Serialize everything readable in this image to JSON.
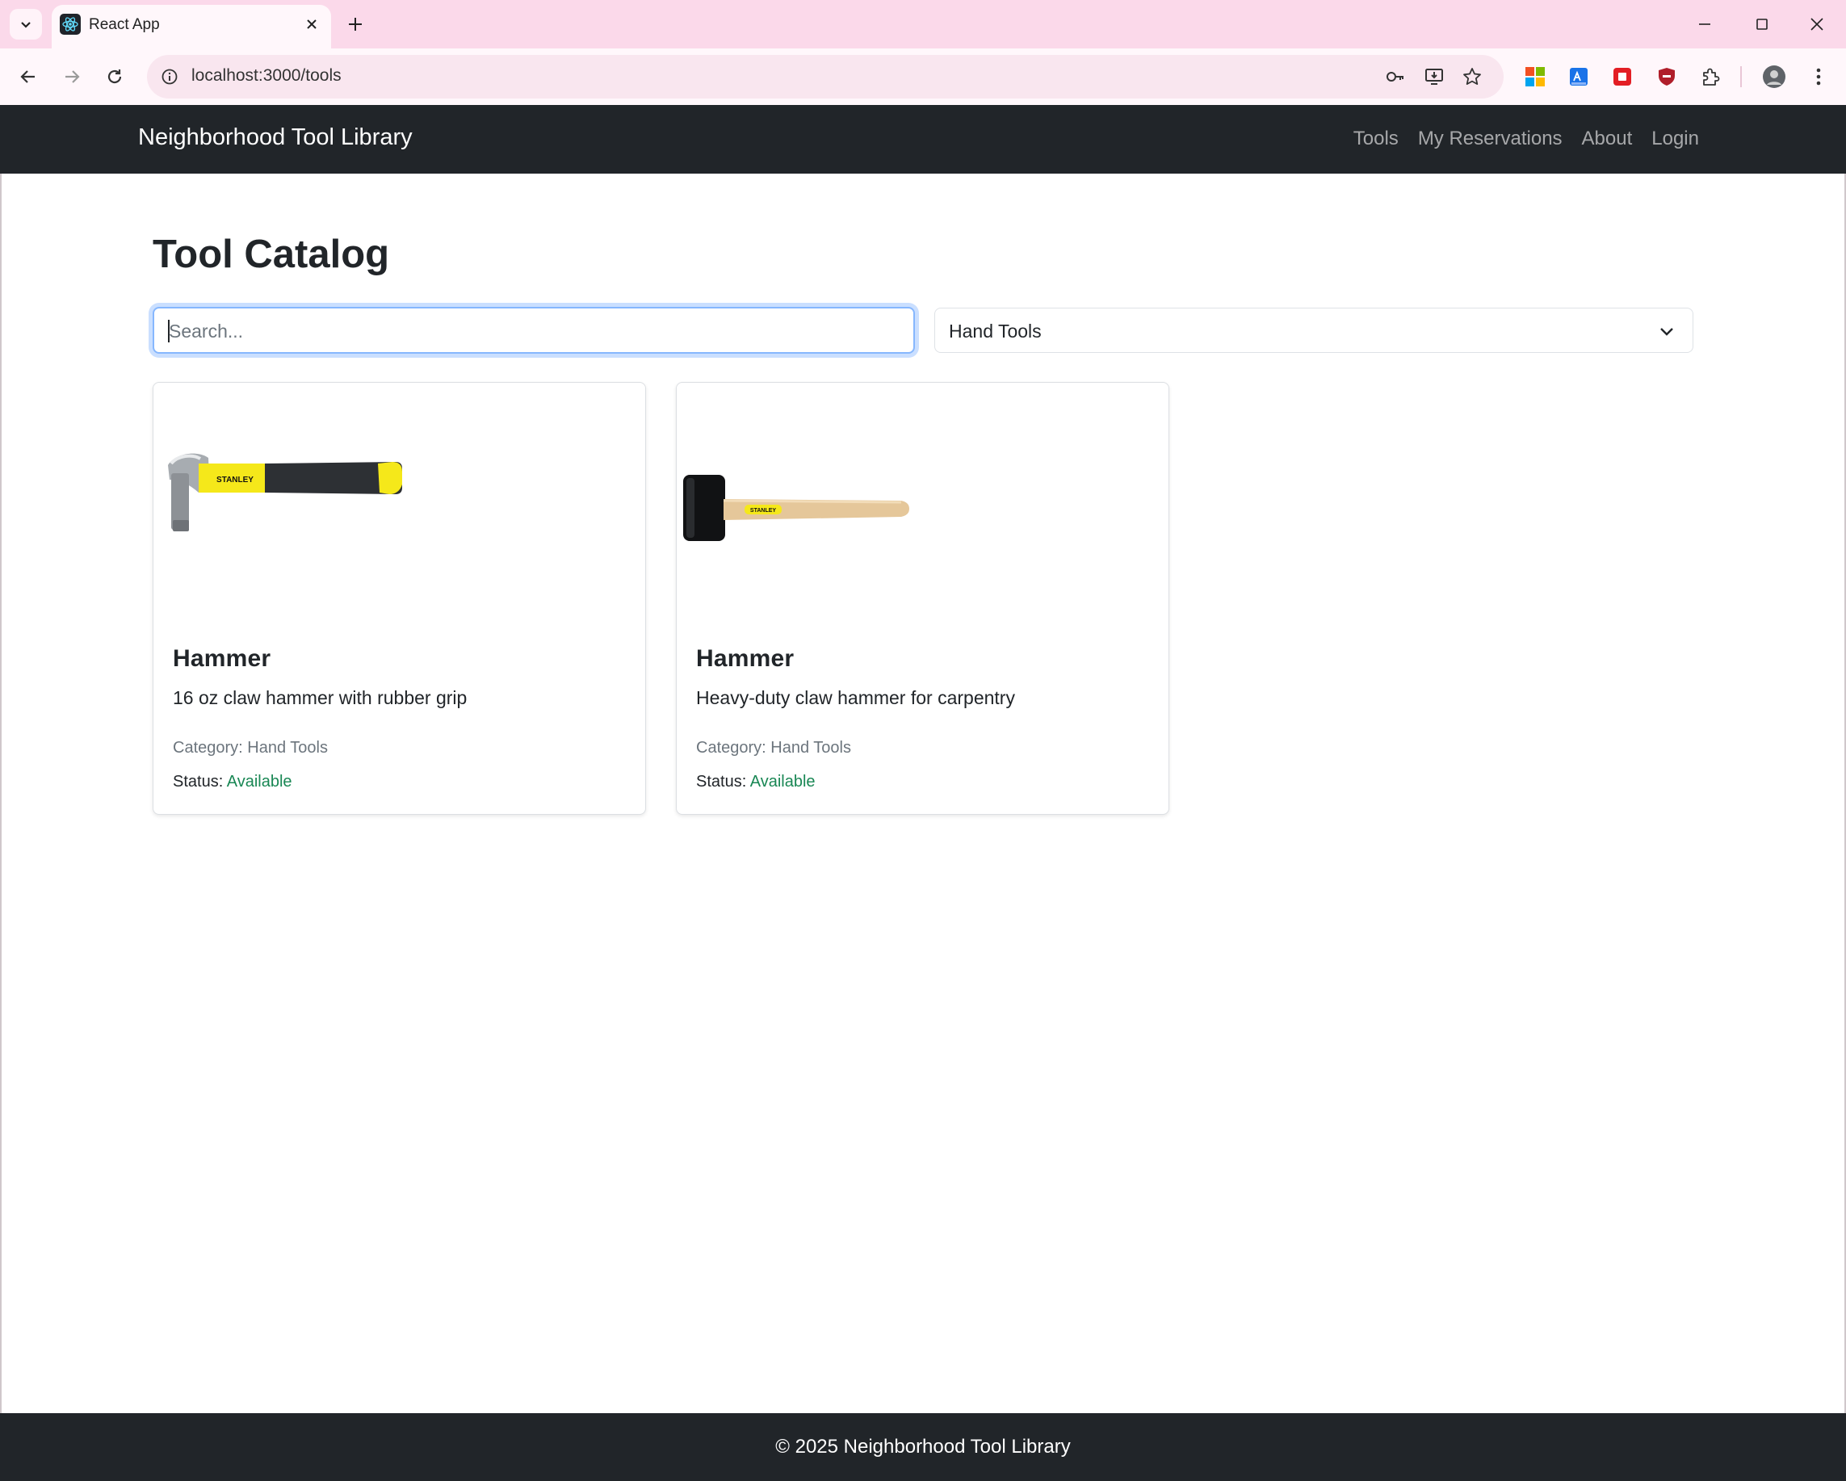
{
  "browser": {
    "tab_title": "React App",
    "url": "localhost:3000/tools"
  },
  "navbar": {
    "brand": "Neighborhood Tool Library",
    "links": [
      "Tools",
      "My Reservations",
      "About",
      "Login"
    ]
  },
  "main": {
    "title": "Tool Catalog",
    "search_placeholder": "Search...",
    "category_selected": "Hand Tools",
    "cards": [
      {
        "image_icon": "claw-hammer-image",
        "image_text": "STANLEY",
        "title": "Hammer",
        "description": "16 oz claw hammer with rubber grip",
        "category_label": "Category:",
        "category": "Hand Tools",
        "status_label": "Status:",
        "status": "Available"
      },
      {
        "image_icon": "rubber-mallet-image",
        "image_text": "STANLEY",
        "title": "Hammer",
        "description": "Heavy-duty claw hammer for carpentry",
        "category_label": "Category:",
        "category": "Hand Tools",
        "status_label": "Status:",
        "status": "Available"
      }
    ]
  },
  "footer": {
    "text": "© 2025 Neighborhood Tool Library"
  },
  "colors": {
    "navbar_bg": "#212529",
    "status_available": "#198754",
    "focus_ring": "#86b7fe",
    "tabstrip_bg": "#fbd9ea"
  }
}
